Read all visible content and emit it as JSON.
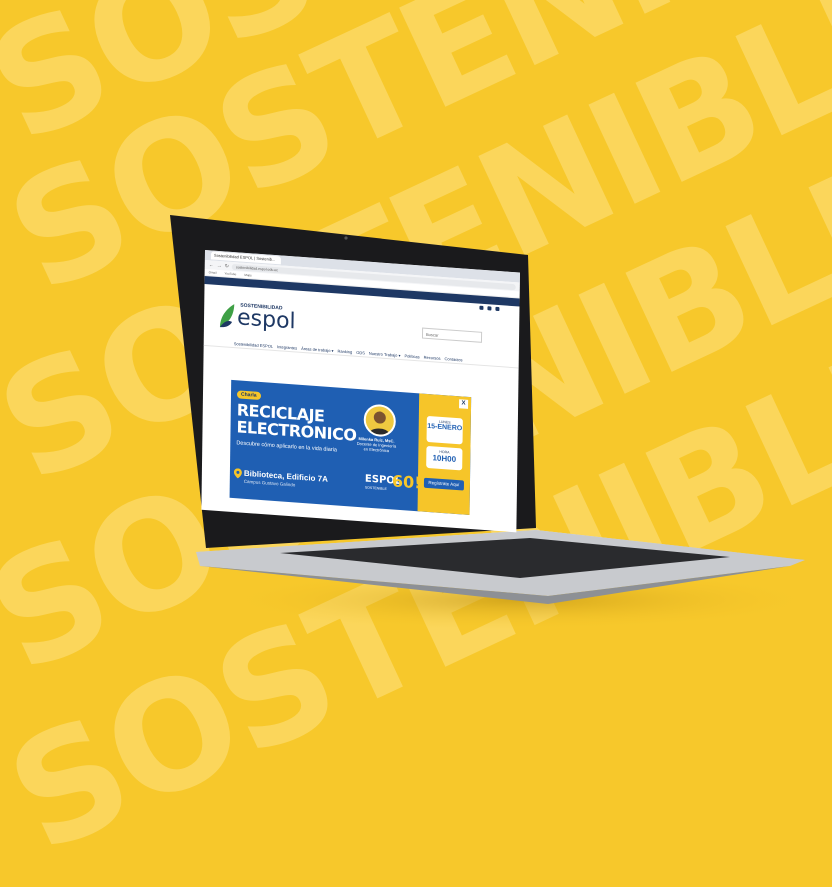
{
  "background": {
    "word": "SOSTENIBLE",
    "color": "#f7c82b"
  },
  "browser": {
    "tab_label": "Sostenibilidad ESPOL | Sostenib...",
    "url": "sostenibilidad.espol.edu.ec",
    "bookmarks": [
      "Gmail",
      "YouTube",
      "Maps"
    ]
  },
  "site": {
    "logo_top": "SOSTENIBILIDAD",
    "logo_main": "espol",
    "search_placeholder": "Buscar",
    "nav": [
      "Sostenibilidad ESPOL",
      "Integrantes",
      "Áreas de trabajo ▾",
      "Ranking",
      "ODS",
      "Nuestro Trabajo ▾",
      "Políticas",
      "Recursos",
      "Contactos"
    ]
  },
  "banner": {
    "chip": "Charla",
    "title_line1": "RECICLAJE",
    "title_line2": "ELECTRONICO",
    "subtitle": "Descubre cómo aplicarlo en la vida diaria",
    "location": "Biblioteca, Edificio 7A",
    "location_sub": "Campus Gustavo Galindo",
    "speaker_name": "Milenka Ruiz, MsC.",
    "speaker_role": "Docente de Ingeniería en Electrónica",
    "espol_mark": "ESPOL",
    "espol_sub": "SOSTENIBLE",
    "sixty": "60!",
    "date_top": "LUNES",
    "date_main": "15-ENERO",
    "hour_top": "HORA",
    "hour_main": "10H00",
    "register": "Regístrate Aquí",
    "close": "X"
  },
  "colors": {
    "navy": "#1e3864",
    "blue": "#1f5fb3",
    "yellow": "#f6c529"
  }
}
